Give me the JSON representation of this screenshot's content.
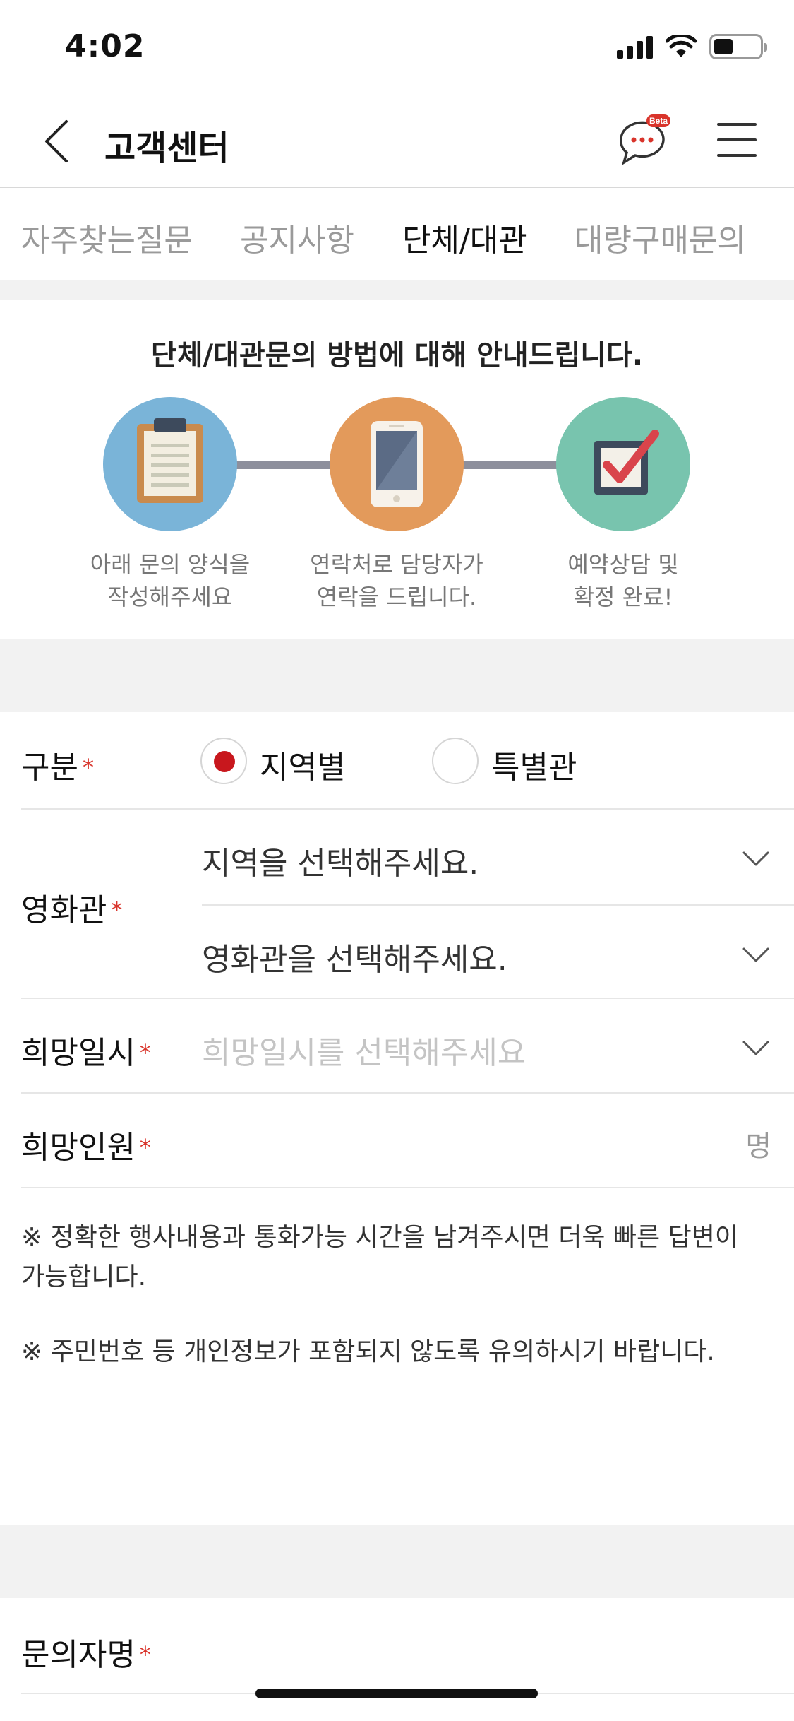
{
  "status_bar": {
    "time": "4:02"
  },
  "header": {
    "title": "고객센터",
    "chat_badge": "Beta"
  },
  "tabs": [
    {
      "label": "자주찾는질문",
      "active": false
    },
    {
      "label": "공지사항",
      "active": false
    },
    {
      "label": "단체/대관",
      "active": true
    },
    {
      "label": "대량구매문의",
      "active": false
    }
  ],
  "guide": {
    "title": "단체/대관문의 방법에 대해 안내드립니다.",
    "steps": [
      {
        "line1": "아래 문의 양식을",
        "line2": "작성해주세요",
        "icon": "clipboard-icon",
        "color": "#7ab4d8"
      },
      {
        "line1": "연락처로 담당자가",
        "line2": "연락을 드립니다.",
        "icon": "phone-icon",
        "color": "#e39a5b"
      },
      {
        "line1": "예약상담 및",
        "line2": "확정 완료!",
        "icon": "checkbox-icon",
        "color": "#78c4ae"
      }
    ]
  },
  "form": {
    "category": {
      "label": "구분",
      "required_mark": "*",
      "options": [
        {
          "label": "지역별",
          "selected": true
        },
        {
          "label": "특별관",
          "selected": false
        }
      ]
    },
    "theater": {
      "label": "영화관",
      "required_mark": "*",
      "region_select": "지역을 선택해주세요.",
      "theater_select": "영화관을 선택해주세요."
    },
    "date": {
      "label": "희망일시",
      "required_mark": "*",
      "placeholder": "희망일시를 선택해주세요"
    },
    "headcount": {
      "label": "희망인원",
      "required_mark": "*",
      "unit": "명"
    },
    "notices": {
      "notice1_line1": "※ 정확한 행사내용과 통화가능 시간을 남겨주시면 더욱 빠른 답변이",
      "notice1_line2": "가능합니다.",
      "notice2": "※ 주민번호 등 개인정보가 포함되지 않도록 유의하시기 바랍니다."
    },
    "name": {
      "label": "문의자명",
      "required_mark": "*"
    }
  },
  "colors": {
    "accent_red": "#c8171d",
    "star_red": "#d9342b",
    "band_gray": "#f2f2f2"
  }
}
